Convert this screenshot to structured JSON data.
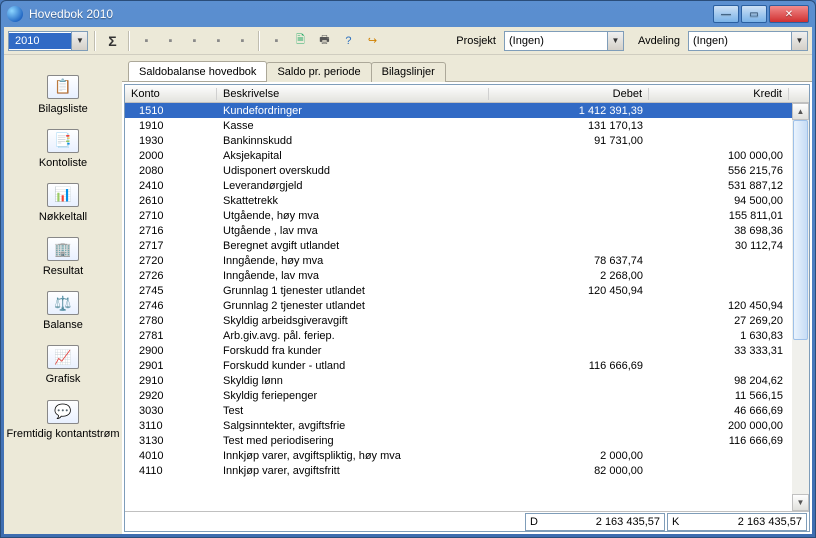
{
  "window": {
    "title": "Hovedbok 2010"
  },
  "toolbar": {
    "year": "2010",
    "prosjekt_label": "Prosjekt",
    "prosjekt_value": "(Ingen)",
    "avdeling_label": "Avdeling",
    "avdeling_value": "(Ingen)"
  },
  "sidebar": {
    "items": [
      {
        "label": "Bilagsliste",
        "icon": "📋"
      },
      {
        "label": "Kontoliste",
        "icon": "📑"
      },
      {
        "label": "Nøkkeltall",
        "icon": "📊"
      },
      {
        "label": "Resultat",
        "icon": "🏢"
      },
      {
        "label": "Balanse",
        "icon": "⚖️"
      },
      {
        "label": "Grafisk",
        "icon": "📈"
      },
      {
        "label": "Fremtidig kontantstrøm",
        "icon": "💬"
      }
    ]
  },
  "tabs": {
    "t0": "Saldobalanse hovedbok",
    "t1": "Saldo pr. periode",
    "t2": "Bilagslinjer"
  },
  "grid": {
    "headers": {
      "konto": "Konto",
      "besk": "Beskrivelse",
      "debet": "Debet",
      "kredit": "Kredit"
    },
    "rows": [
      {
        "konto": "1510",
        "besk": "Kundefordringer",
        "debet": "1 412 391,39",
        "kredit": "",
        "sel": true
      },
      {
        "konto": "1910",
        "besk": "Kasse",
        "debet": "131 170,13",
        "kredit": ""
      },
      {
        "konto": "1930",
        "besk": "Bankinnskudd",
        "debet": "91 731,00",
        "kredit": ""
      },
      {
        "konto": "2000",
        "besk": "Aksjekapital",
        "debet": "",
        "kredit": "100 000,00"
      },
      {
        "konto": "2080",
        "besk": "Udisponert overskudd",
        "debet": "",
        "kredit": "556 215,76"
      },
      {
        "konto": "2410",
        "besk": "Leverandørgjeld",
        "debet": "",
        "kredit": "531 887,12"
      },
      {
        "konto": "2610",
        "besk": "Skattetrekk",
        "debet": "",
        "kredit": "94 500,00"
      },
      {
        "konto": "2710",
        "besk": "Utgående, høy mva",
        "debet": "",
        "kredit": "155 811,01"
      },
      {
        "konto": "2716",
        "besk": "Utgående , lav mva",
        "debet": "",
        "kredit": "38 698,36"
      },
      {
        "konto": "2717",
        "besk": "Beregnet avgift utlandet",
        "debet": "",
        "kredit": "30 112,74"
      },
      {
        "konto": "2720",
        "besk": "Inngående, høy mva",
        "debet": "78 637,74",
        "kredit": ""
      },
      {
        "konto": "2726",
        "besk": "Inngående, lav mva",
        "debet": "2 268,00",
        "kredit": ""
      },
      {
        "konto": "2745",
        "besk": "Grunnlag 1 tjenester utlandet",
        "debet": "120 450,94",
        "kredit": ""
      },
      {
        "konto": "2746",
        "besk": "Grunnlag 2 tjenester utlandet",
        "debet": "",
        "kredit": "120 450,94"
      },
      {
        "konto": "2780",
        "besk": "Skyldig arbeidsgiveravgift",
        "debet": "",
        "kredit": "27 269,20"
      },
      {
        "konto": "2781",
        "besk": "Arb.giv.avg. pål. feriep.",
        "debet": "",
        "kredit": "1 630,83"
      },
      {
        "konto": "2900",
        "besk": "Forskudd fra kunder",
        "debet": "",
        "kredit": "33 333,31"
      },
      {
        "konto": "2901",
        "besk": "Forskudd kunder - utland",
        "debet": "116 666,69",
        "kredit": ""
      },
      {
        "konto": "2910",
        "besk": "Skyldig lønn",
        "debet": "",
        "kredit": "98 204,62"
      },
      {
        "konto": "2920",
        "besk": "Skyldig feriepenger",
        "debet": "",
        "kredit": "11 566,15"
      },
      {
        "konto": "3030",
        "besk": "Test",
        "debet": "",
        "kredit": "46 666,69"
      },
      {
        "konto": "3110",
        "besk": "Salgsinntekter, avgiftsfrie",
        "debet": "",
        "kredit": "200 000,00"
      },
      {
        "konto": "3130",
        "besk": "Test med periodisering",
        "debet": "",
        "kredit": "116 666,69"
      },
      {
        "konto": "4010",
        "besk": "Innkjøp varer, avgiftspliktig, høy mva",
        "debet": "2 000,00",
        "kredit": ""
      },
      {
        "konto": "4110",
        "besk": "Innkjøp varer, avgiftsfritt",
        "debet": "82 000,00",
        "kredit": ""
      }
    ]
  },
  "footer": {
    "debet_label": "D",
    "debet_value": "2 163 435,57",
    "kredit_label": "K",
    "kredit_value": "2 163 435,57"
  }
}
